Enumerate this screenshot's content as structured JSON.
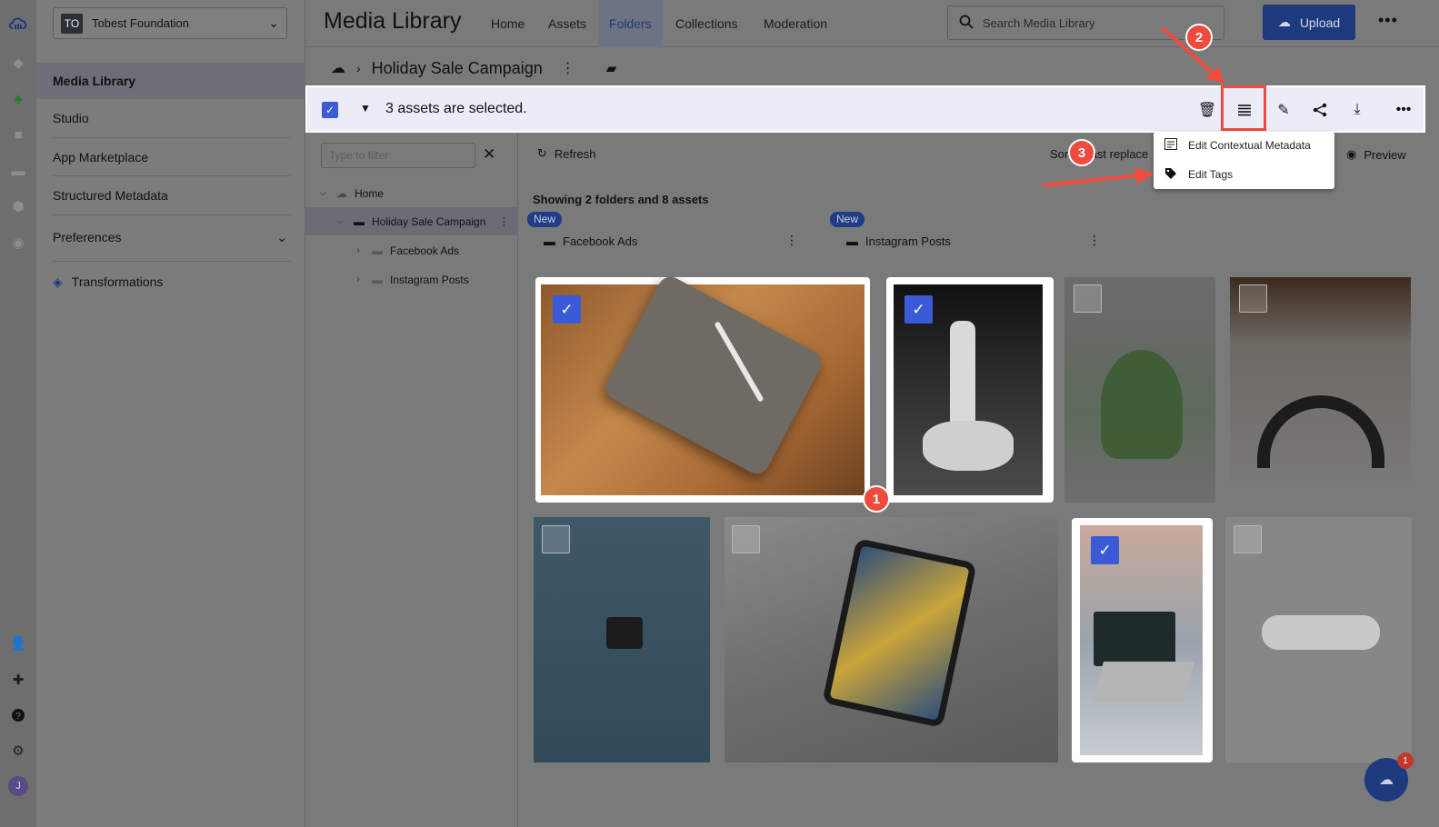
{
  "org": {
    "initials": "TO",
    "name": "Tobest Foundation"
  },
  "sidenav": {
    "media_library": "Media Library",
    "studio": "Studio",
    "app_marketplace": "App Marketplace",
    "structured_metadata": "Structured Metadata",
    "preferences": "Preferences",
    "transformations": "Transformations"
  },
  "header": {
    "title": "Media Library",
    "tabs": [
      "Home",
      "Assets",
      "Folders",
      "Collections",
      "Moderation"
    ],
    "active_tab": "Folders",
    "search_placeholder": "Search Media Library",
    "upload_label": "Upload"
  },
  "breadcrumb": {
    "current": "Holiday Sale Campaign"
  },
  "selection": {
    "text": "3 assets are selected."
  },
  "tree": {
    "filter_placeholder": "Type to filter",
    "items": [
      "Home",
      "Holiday Sale Campaign",
      "Facebook Ads",
      "Instagram Posts"
    ]
  },
  "toolbar": {
    "refresh": "Refresh",
    "sort": "Sort",
    "sort_value": "Last replace",
    "preview": "Preview"
  },
  "showing": "Showing 2 folders and 8 assets",
  "folders": [
    {
      "badge": "New",
      "name": "Facebook Ads"
    },
    {
      "badge": "New",
      "name": "Instagram Posts"
    }
  ],
  "dropdown": {
    "item1": "Edit Contextual Metadata",
    "item2": "Edit Tags"
  },
  "markers": [
    "1",
    "2",
    "3"
  ],
  "fab": {
    "count": "1"
  },
  "user_initial": "J",
  "colors": {
    "accent": "#3b5bd6",
    "brand": "#1d3a7e",
    "annotation": "#ef4a3c"
  }
}
